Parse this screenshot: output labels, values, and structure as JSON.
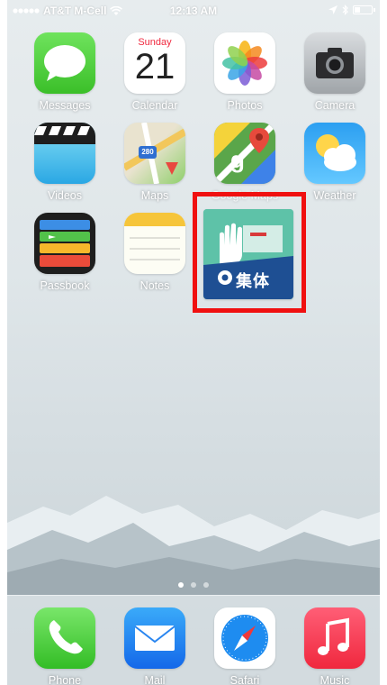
{
  "status_bar": {
    "carrier": "AT&T M-Cell",
    "time": "12:13 AM"
  },
  "home_apps": [
    {
      "label": "Messages",
      "icon": "messages-icon"
    },
    {
      "label": "Calendar",
      "icon": "calendar-icon",
      "weekday": "Sunday",
      "day": "21"
    },
    {
      "label": "Photos",
      "icon": "photos-icon"
    },
    {
      "label": "Camera",
      "icon": "camera-icon"
    },
    {
      "label": "Videos",
      "icon": "videos-icon"
    },
    {
      "label": "Maps",
      "icon": "maps-icon",
      "road_sign": "280"
    },
    {
      "label": "Google Maps",
      "icon": "google-maps-icon"
    },
    {
      "label": "Weather",
      "icon": "weather-icon"
    },
    {
      "label": "Passbook",
      "icon": "passbook-icon"
    },
    {
      "label": "Notes",
      "icon": "notes-icon"
    },
    {
      "label": "",
      "icon": "custom-app-icon",
      "mark": "集体"
    }
  ],
  "page_dots": {
    "count": 3,
    "active": 0
  },
  "dock_apps": [
    {
      "label": "Phone",
      "icon": "phone-icon"
    },
    {
      "label": "Mail",
      "icon": "mail-icon"
    },
    {
      "label": "Safari",
      "icon": "safari-icon"
    },
    {
      "label": "Music",
      "icon": "music-icon"
    }
  ],
  "colors": {
    "highlight_border": "#f01010",
    "status_text": "#ffffff"
  }
}
